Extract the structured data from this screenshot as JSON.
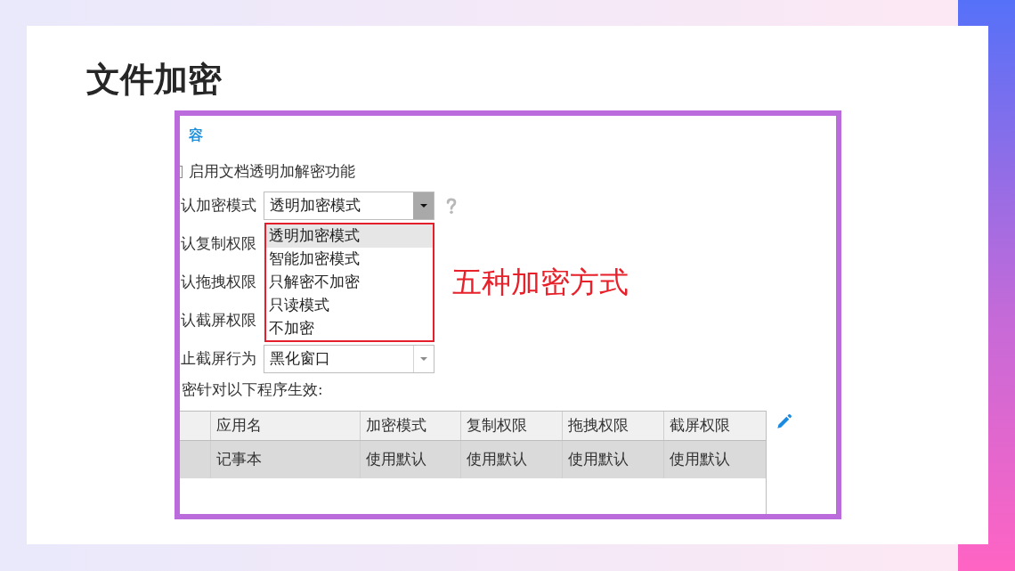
{
  "slide": {
    "title": "文件加密"
  },
  "screenshot": {
    "section_heading": "容",
    "checkbox": {
      "label": "启用文档透明加解密功能",
      "checked": false
    },
    "fields": [
      {
        "kind": "dropdown",
        "label": "认加密模式",
        "value": "透明加密模式",
        "expanded": true,
        "help": true,
        "options": [
          {
            "label": "透明加密模式",
            "selected": true
          },
          {
            "label": "智能加密模式",
            "selected": false
          },
          {
            "label": "只解密不加密",
            "selected": false
          },
          {
            "label": "只读模式",
            "selected": false
          },
          {
            "label": "不加密",
            "selected": false
          }
        ]
      },
      {
        "kind": "label",
        "label": "认复制权限"
      },
      {
        "kind": "label",
        "label": "认拖拽权限"
      },
      {
        "kind": "label",
        "label": "认截屏权限"
      },
      {
        "kind": "dropdown",
        "label": "止截屏行为",
        "value": "黑化窗口",
        "expanded": false
      }
    ],
    "annotation": "五种加密方式",
    "table_caption": "密针对以下程序生效:",
    "table": {
      "columns": [
        "应用名",
        "加密模式",
        "复制权限",
        "拖拽权限",
        "截屏权限"
      ],
      "rows": [
        {
          "selected": true,
          "cells": [
            "记事本",
            "使用默认",
            "使用默认",
            "使用默认",
            "使用默认"
          ]
        }
      ]
    }
  }
}
